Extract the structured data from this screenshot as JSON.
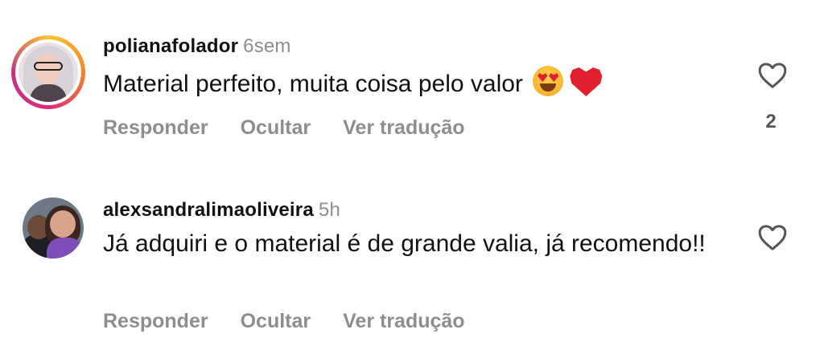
{
  "comments": [
    {
      "username": "polianafolador",
      "time": "6sem",
      "text": "Material perfeito, muita coisa pelo valor",
      "emojis": [
        "heart-eyes-emoji",
        "red-heart-emoji"
      ],
      "has_story_ring": true,
      "actions": {
        "reply": "Responder",
        "hide": "Ocultar",
        "translate": "Ver tradução"
      },
      "like_count": "2"
    },
    {
      "username": "alexsandralimaoliveira",
      "time": "5h",
      "text": "Já adquiri e o material é de grande valia, já recomendo!!",
      "has_story_ring": false,
      "actions": {
        "reply": "Responder",
        "hide": "Ocultar",
        "translate": "Ver tradução"
      }
    }
  ],
  "icons": {
    "like": "heart-outline-icon"
  },
  "colors": {
    "secondary_text": "#8e8e8e",
    "primary_text": "#111111",
    "emoji_red": "#e0202c"
  }
}
